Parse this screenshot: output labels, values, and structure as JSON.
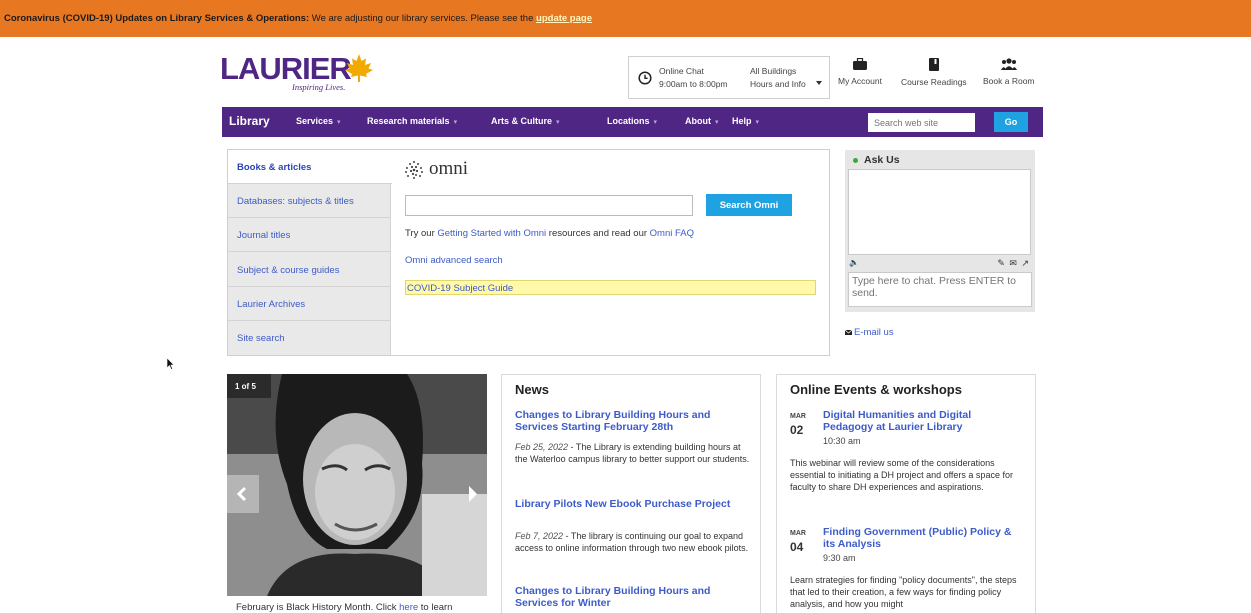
{
  "alert": {
    "bold": "Coronavirus (COVID-19) Updates on Library Services & Operations:",
    "text": " We are adjusting our library services. Please see the ",
    "link": "update page"
  },
  "logo": {
    "word": "LAURIER",
    "tagline": "Inspiring Lives."
  },
  "hours": {
    "chat_label": "Online Chat",
    "chat_hours": "9:00am to 8:00pm",
    "buildings_label": "All Buildings",
    "buildings_sub": "Hours and Info"
  },
  "header_links": [
    "My Account",
    "Course Readings",
    "Book a Room"
  ],
  "nav": {
    "brand": "Library",
    "items": [
      "Services",
      "Research materials",
      "Arts & Culture",
      "Locations",
      "About",
      "Help"
    ],
    "dropdown_glyph": "▾",
    "search_placeholder": "Search web site",
    "go_label": "Go"
  },
  "tabs": [
    "Books & articles",
    "Databases: subjects & titles",
    "Journal titles",
    "Subject & course guides",
    "Laurier Archives",
    "Site search"
  ],
  "omni": {
    "logo_word": "omni",
    "search_button": "Search Omni",
    "line_pre": "Try our ",
    "line_link1": "Getting Started with Omni",
    "line_mid": " resources and read our ",
    "line_link2": "Omni FAQ",
    "advanced": "Omni advanced search",
    "covid_guide": "COVID-19 Subject Guide"
  },
  "ask": {
    "title": "Ask Us",
    "sound_glyph": "🔈",
    "tool_glyphs": "✎ ✉ ↗",
    "placeholder": "Type here to chat. Press ENTER to send.",
    "email": "E-mail us"
  },
  "carousel": {
    "pager": "1 of 5",
    "caption_pre": "February is Black History Month. Click ",
    "caption_link": "here",
    "caption_post": " to learn"
  },
  "news": {
    "title": "News",
    "items": [
      {
        "headline": "Changes to Library Building Hours and Services Starting February 28th",
        "date": "Feb 25, 2022",
        "text": " - The Library is extending building hours at the Waterloo campus library to better support our students."
      },
      {
        "headline": "Library Pilots New Ebook Purchase Project",
        "date": "Feb 7, 2022",
        "text": " - The library is continuing our goal to expand access to online information through two new ebook pilots."
      },
      {
        "headline": "Changes to Library Building Hours and Services for Winter"
      }
    ]
  },
  "events": {
    "title": "Online Events & workshops",
    "items": [
      {
        "month": "MAR",
        "day": "02",
        "title": "Digital Humanities and Digital Pedagogy at Laurier Library",
        "time": "10:30 am",
        "desc": "This webinar will review some of the considerations essential to initiating a DH project and offers a space for faculty to share DH experiences and aspirations."
      },
      {
        "month": "MAR",
        "day": "04",
        "title": "Finding Government (Public) Policy & its Analysis",
        "time": "9:30 am",
        "desc": "Learn strategies for finding \"policy documents\", the steps that led to their creation, a few ways for finding policy analysis, and how you might"
      }
    ]
  },
  "colors": {
    "alert": "#e87722",
    "brand_purple": "#4f2683",
    "accent_blue": "#1ea2e1",
    "link_blue": "#3d5bc9",
    "gold": "#f2a900"
  }
}
